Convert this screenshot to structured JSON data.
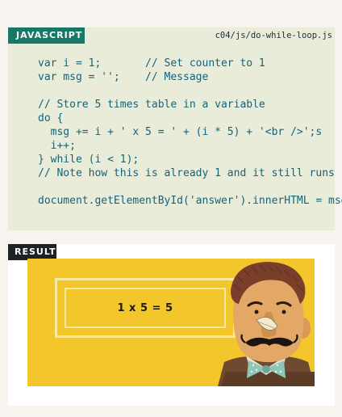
{
  "javascript_panel": {
    "tab_label": "JAVASCRIPT",
    "file_path": "c04/js/do-while-loop.js",
    "code_lines": [
      "var i = 1;       // Set counter to 1",
      "var msg = '';    // Message",
      "",
      "// Store 5 times table in a variable",
      "do {",
      "  msg += i + ' x 5 = ' + (i * 5) + '<br />';s",
      "  i++;",
      "} while (i < 1);",
      "// Note how this is already 1 and it still runs",
      "",
      "document.getElementById('answer').innerHTML = msg;"
    ]
  },
  "result_panel": {
    "tab_label": "RESULT",
    "answer_text": "1 x 5 = 5"
  },
  "colors": {
    "page_background": "#f7f4ef",
    "code_panel_background": "#e9ecd9",
    "javascript_tab": "#177868",
    "result_tab": "#1f2224",
    "code_text": "#16627a",
    "stage_yellow": "#f3c62c",
    "frame_cream": "#fbe7a4"
  },
  "illustration": {
    "icon": "mustached-man-illustration"
  }
}
